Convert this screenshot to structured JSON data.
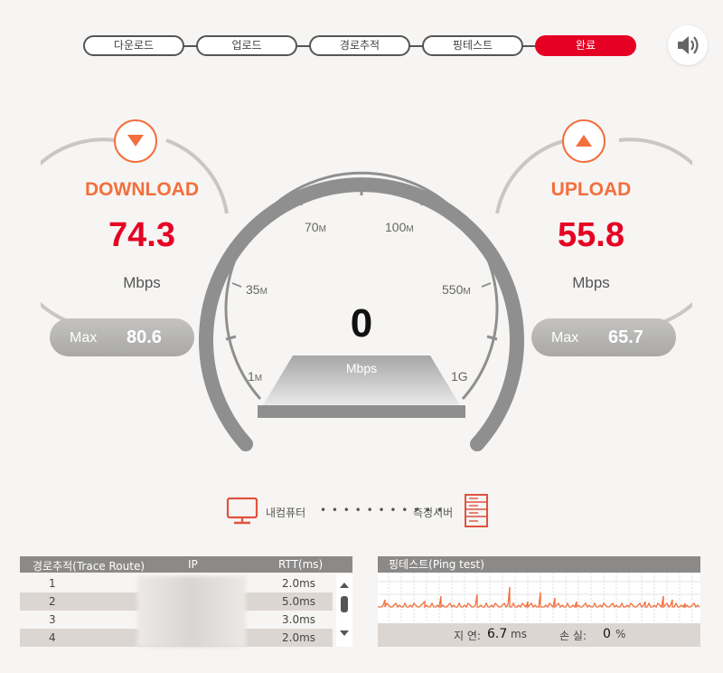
{
  "steps": [
    "다운로드",
    "업로드",
    "경로추적",
    "핑테스트",
    "완료"
  ],
  "download": {
    "title": "DOWNLOAD",
    "value": "74.3",
    "unit": "Mbps",
    "max_label": "Max",
    "max_value": "80.6"
  },
  "upload": {
    "title": "UPLOAD",
    "value": "55.8",
    "unit": "Mbps",
    "max_label": "Max",
    "max_value": "65.7"
  },
  "gauge": {
    "speed": "0",
    "unit": "Mbps",
    "ticks": [
      {
        "num": "1",
        "suffix": "M"
      },
      {
        "num": "35",
        "suffix": "M"
      },
      {
        "num": "70",
        "suffix": "M"
      },
      {
        "num": "100",
        "suffix": "M"
      },
      {
        "num": "550",
        "suffix": "M"
      },
      {
        "num": "1G",
        "suffix": ""
      }
    ]
  },
  "connection": {
    "pc_label": "내컴퓨터",
    "dots": "• • • • • • • • • • •",
    "server_label": "측정서버"
  },
  "trace": {
    "headers": {
      "hop": "경로추적(Trace Route)",
      "ip": "IP",
      "rtt": "RTT(ms)"
    },
    "rows": [
      {
        "hop": "1",
        "rtt": "2.0ms"
      },
      {
        "hop": "2",
        "rtt": "5.0ms"
      },
      {
        "hop": "3",
        "rtt": "3.0ms"
      },
      {
        "hop": "4",
        "rtt": "2.0ms"
      }
    ]
  },
  "ping": {
    "title": "핑테스트(Ping test)",
    "latency_label": "지 연:",
    "latency_value": "6.7",
    "latency_unit": "ms",
    "loss_label": "손 실:",
    "loss_value": "0",
    "loss_unit": "%"
  },
  "colors": {
    "accent_red": "#e60023",
    "accent_orange": "#f26f3d",
    "gauge_gray": "#8f8f8f"
  },
  "icons": [
    "speaker-icon",
    "arrow-down-icon",
    "arrow-up-icon",
    "computer-icon",
    "server-icon",
    "scroll-up-icon",
    "scroll-down-icon"
  ]
}
